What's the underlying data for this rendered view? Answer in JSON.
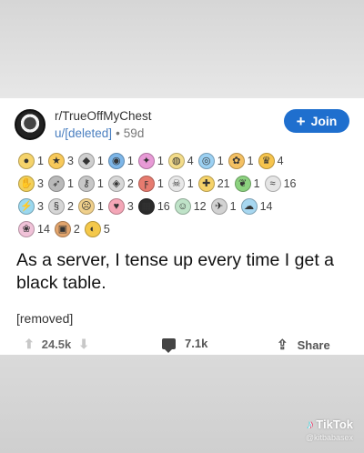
{
  "post": {
    "subreddit": "r/TrueOffMyChest",
    "author": "u/[deleted]",
    "age": "59d",
    "join_label": "Join",
    "title": "As a server, I tense up every time I get a black table.",
    "body": "[removed]"
  },
  "awards": [
    [
      {
        "icon": "gold-medal-icon",
        "count": "1",
        "color": "#f5d36b"
      },
      {
        "icon": "star-icon",
        "count": "3",
        "color": "#f8c95a"
      },
      {
        "icon": "bowing-icon",
        "count": "1",
        "color": "#cfcfcf"
      },
      {
        "icon": "drink-icon",
        "count": "1",
        "color": "#7db6e8"
      },
      {
        "icon": "party-icon",
        "count": "1",
        "color": "#e89ad6"
      },
      {
        "icon": "wholesome-icon",
        "count": "4",
        "color": "#f3dc8a"
      },
      {
        "icon": "eye-icon",
        "count": "1",
        "color": "#9cd1f3"
      },
      {
        "icon": "hug-icon",
        "count": "1",
        "color": "#f4c063"
      },
      {
        "icon": "crown-icon",
        "count": "4",
        "color": "#f6c44d"
      }
    ],
    [
      {
        "icon": "clapping-icon",
        "count": "3",
        "color": "#f2d05a"
      },
      {
        "icon": "rocket-icon",
        "count": "1",
        "color": "#b9b9b9"
      },
      {
        "icon": "key-icon",
        "count": "1",
        "color": "#c7c7c7"
      },
      {
        "icon": "silver-icon",
        "count": "2",
        "color": "#d8d8d8"
      },
      {
        "icon": "press-f-icon",
        "count": "1",
        "color": "#e67b6f"
      },
      {
        "icon": "skull-icon",
        "count": "1",
        "color": "#e8e8e8"
      },
      {
        "icon": "helpful-icon",
        "count": "21",
        "color": "#f5d269"
      },
      {
        "icon": "plant-icon",
        "count": "1",
        "color": "#8cd27f"
      },
      {
        "icon": "wave-icon",
        "count": "16",
        "color": "#e5e5e5"
      }
    ],
    [
      {
        "icon": "take-my-energy-icon",
        "count": "3",
        "color": "#9bd8ef"
      },
      {
        "icon": "s-coin-icon",
        "count": "2",
        "color": "#d6d6d6"
      },
      {
        "icon": "facepalm-icon",
        "count": "1",
        "color": "#f0d08b"
      },
      {
        "icon": "heart-eyes-icon",
        "count": "3",
        "color": "#f4a6b7"
      },
      {
        "icon": "pixel-bar-icon",
        "count": "16",
        "color": "#2b2b2b"
      },
      {
        "icon": "angel-icon",
        "count": "12",
        "color": "#bfe3c8"
      },
      {
        "icon": "bird-icon",
        "count": "1",
        "color": "#d2d2d2"
      },
      {
        "icon": "ghost-icon",
        "count": "14",
        "color": "#a7d7f0"
      }
    ],
    [
      {
        "icon": "bouquet-icon",
        "count": "14",
        "color": "#f0c2d8"
      },
      {
        "icon": "gift-icon",
        "count": "2",
        "color": "#e2a46c"
      },
      {
        "icon": "sunglasses-icon",
        "count": "5",
        "color": "#f4c84a"
      }
    ]
  ],
  "actions": {
    "upvotes": "24.5k",
    "comments": "7.1k",
    "share_label": "Share"
  },
  "watermark": {
    "brand": "TikTok",
    "handle": "@kitbabasex"
  }
}
